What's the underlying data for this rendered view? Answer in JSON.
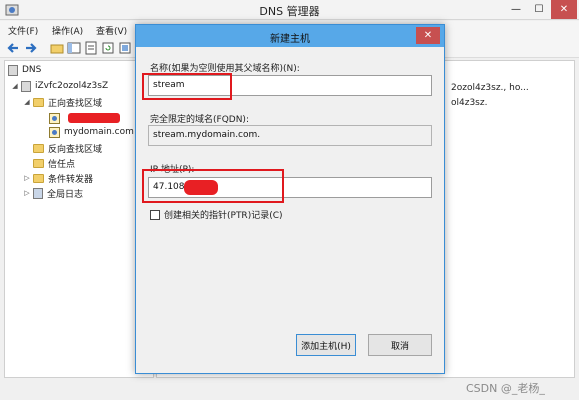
{
  "window": {
    "title": "DNS 管理器",
    "controls": {
      "minimize": "—",
      "maximize": "☐",
      "close": "✕"
    }
  },
  "menu": [
    "文件(F)",
    "操作(A)",
    "查看(V)"
  ],
  "tree": {
    "root": "DNS",
    "server": "iZvfc2ozol4z3sZ",
    "forward_zones": "正向查找区域",
    "zone_selected": "",
    "zone_mydomain": "mydomain.com",
    "reverse_zones": "反向查找区域",
    "trust_points": "信任点",
    "conditional_forwarders": "条件转发器",
    "global_logs": "全局日志"
  },
  "list": {
    "row1": "2ozol4z3sz., ho...",
    "row2": "ol4z3sz."
  },
  "dialog": {
    "title": "新建主机",
    "close": "✕",
    "name_label": "名称(如果为空则使用其父域名称)(N):",
    "name_value": "stream",
    "fqdn_label": "完全限定的域名(FQDN):",
    "fqdn_value": "stream.mydomain.com.",
    "ip_label": "IP 地址(P):",
    "ip_value": "47.108.",
    "ptr_checkbox_label": "创建相关的指针(PTR)记录(C)",
    "ptr_checked": false,
    "add_button": "添加主机(H)",
    "cancel_button": "取消"
  },
  "watermark": "CSDN @_老杨_",
  "colors": {
    "dialog_title_bar": "#57a8e8",
    "close_button": "#c75050",
    "highlight_box": "#e0191e"
  }
}
